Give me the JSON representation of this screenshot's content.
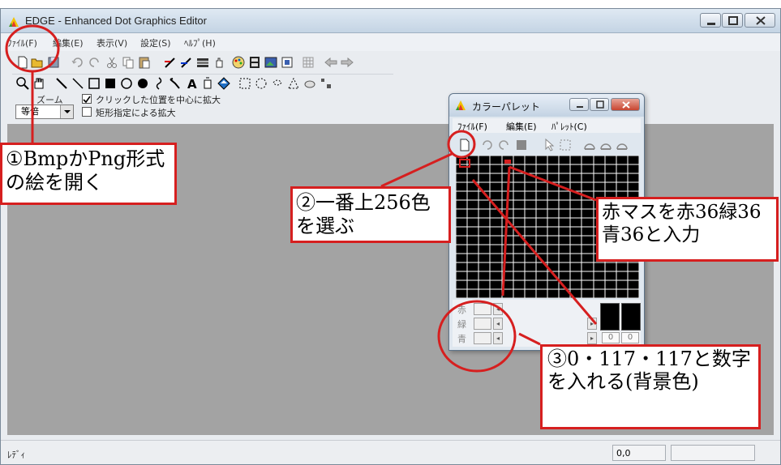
{
  "window": {
    "title": "EDGE - Enhanced Dot Graphics Editor"
  },
  "menu": [
    {
      "label": "ﾌｧｲﾙ(F)"
    },
    {
      "label": "編集(E)"
    },
    {
      "label": "表示(V)"
    },
    {
      "label": "設定(S)"
    },
    {
      "label": "ﾍﾙﾌﾟ(H)"
    }
  ],
  "zoom": {
    "label": "ズーム",
    "value": "等倍",
    "option1_label": "クリックした位置を中心に拡大",
    "option1_checked": true,
    "option2_label": "矩形指定による拡大",
    "option2_checked": false
  },
  "status": {
    "text": "ﾚﾃﾞｨ",
    "coord": "0,0"
  },
  "palette": {
    "title": "カラーパレット",
    "menu": [
      {
        "label": "ﾌｧｲﾙ(F)"
      },
      {
        "label": "編集(E)"
      },
      {
        "label": "ﾊﾟﾚｯﾄ(C)"
      }
    ],
    "red_label": "赤",
    "green_label": "緑",
    "blue_label": "青",
    "value_left": "0",
    "value_right": "0"
  },
  "annotations": {
    "note1": "①BmpかPng形式の絵を開く",
    "note2": "②一番上256色を選ぶ",
    "note3": "赤マスを赤36緑36青36と入力",
    "note4": "③0・117・117と数字を入れる(背景色)"
  },
  "colors": {
    "annotation_red": "#d61f1f",
    "canvas_gray": "#a3a3a3"
  }
}
